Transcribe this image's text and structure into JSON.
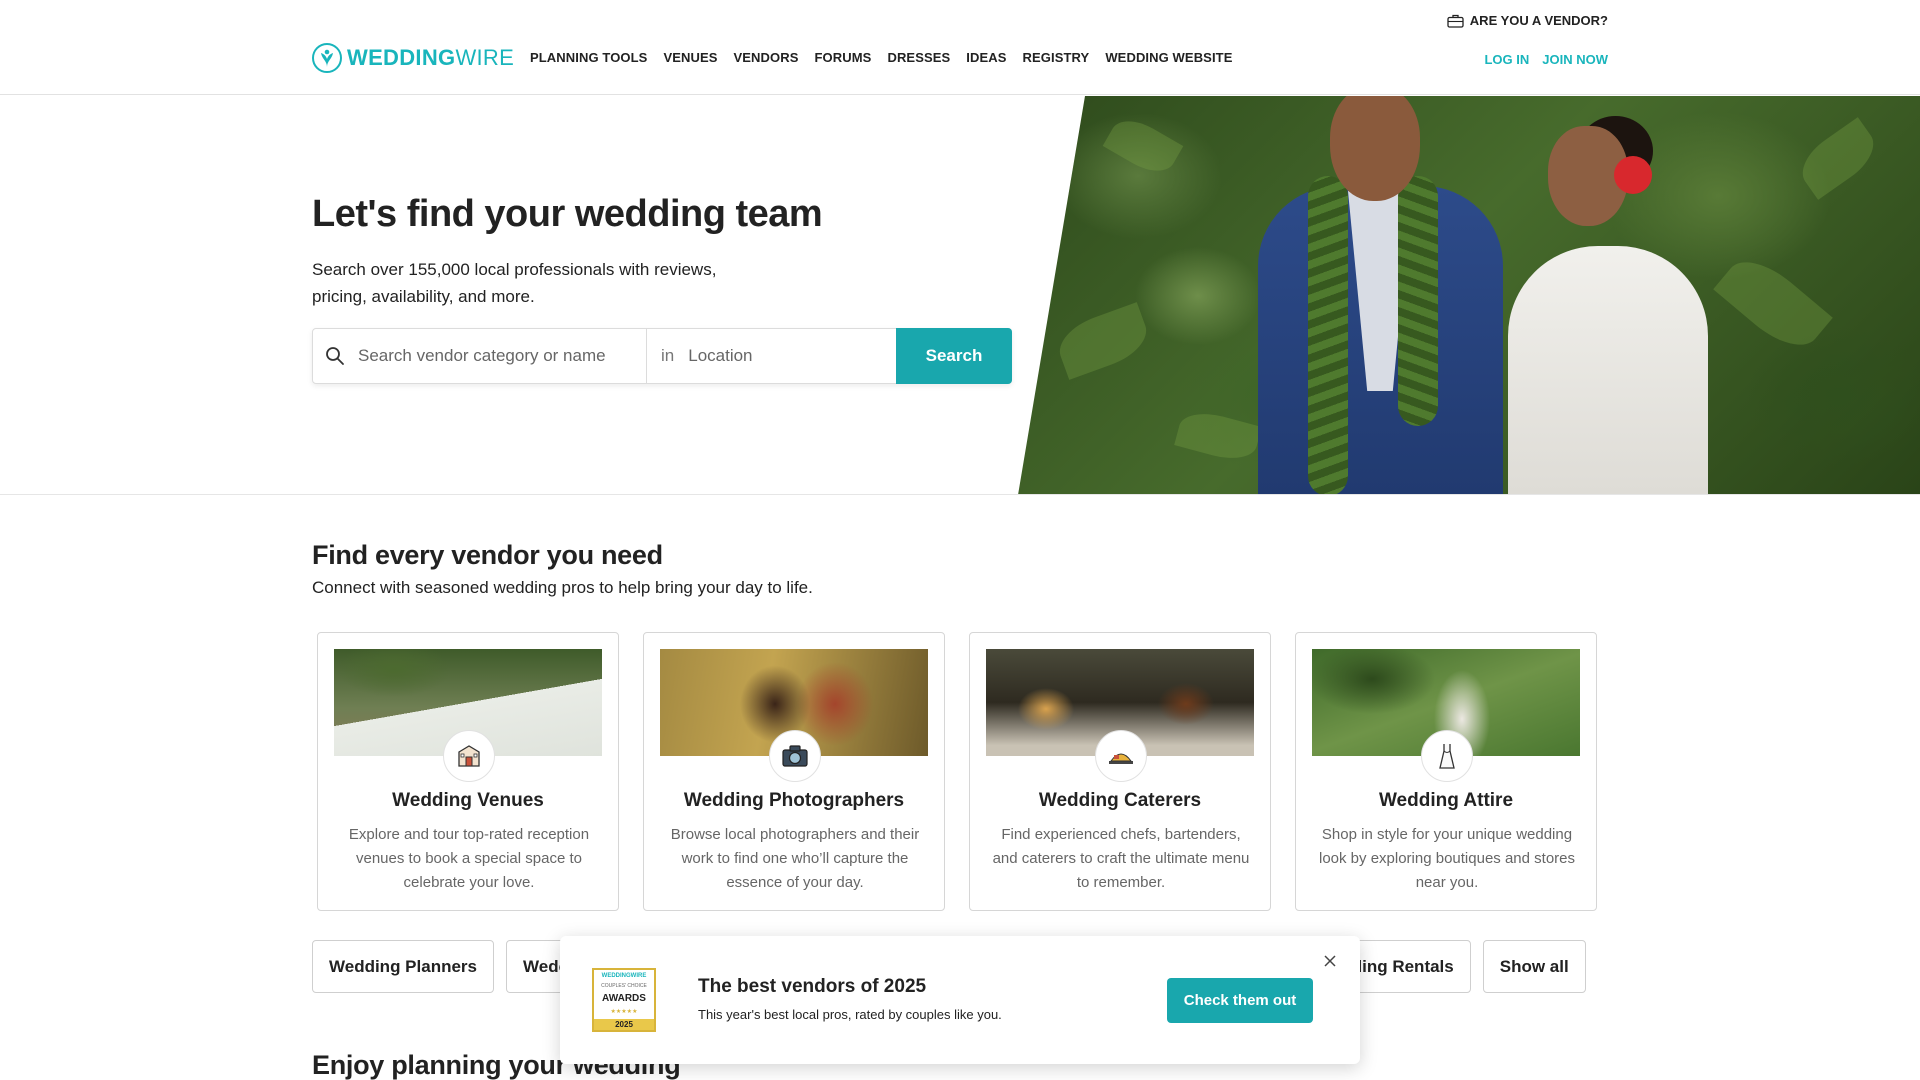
{
  "header": {
    "vendor_link": "ARE YOU A VENDOR?",
    "logo": {
      "part1": "WEDDING",
      "part2": "WIRE"
    },
    "nav": [
      "PLANNING TOOLS",
      "VENUES",
      "VENDORS",
      "FORUMS",
      "DRESSES",
      "IDEAS",
      "REGISTRY",
      "WEDDING WEBSITE"
    ],
    "login": "LOG IN",
    "join": "JOIN NOW"
  },
  "hero": {
    "title": "Let's find your wedding team",
    "subtitle": "Search over 155,000 local professionals with reviews, pricing, availability, and more.",
    "search": {
      "category_placeholder": "Search vendor category or name",
      "in_label": "in",
      "location_placeholder": "Location",
      "button": "Search"
    }
  },
  "vendors": {
    "title": "Find every vendor you need",
    "subtitle": "Connect with seasoned wedding pros to help bring your day to life.",
    "cards": [
      {
        "title": "Wedding Venues",
        "desc": "Explore and tour top-rated reception venues to book a special space to celebrate your love.",
        "icon": "venue-icon"
      },
      {
        "title": "Wedding Photographers",
        "desc": "Browse local photographers and their work to find one who’ll capture the essence of your day.",
        "icon": "camera-icon"
      },
      {
        "title": "Wedding Caterers",
        "desc": "Find experienced chefs, bartenders, and caterers to craft the ultimate menu to remember.",
        "icon": "catering-icon"
      },
      {
        "title": "Wedding Attire",
        "desc": "Shop in style for your unique wedding look by exploring boutiques and stores near you.",
        "icon": "dress-icon"
      }
    ],
    "pills": [
      "Wedding Planners",
      "Wedc",
      "lding Rentals",
      "Show all"
    ]
  },
  "next_section_title": "Enjoy planning your wedding",
  "toast": {
    "award": {
      "brand": "WEDDINGWIRE",
      "line": "COUPLES' CHOICE",
      "name": "AWARDS",
      "stars": "★★★★★",
      "year": "2025"
    },
    "title": "The best vendors of 2025",
    "subtitle": "This year's best local pros, rated by couples like you.",
    "button": "Check them out"
  },
  "colors": {
    "brand_teal": "#19b5bc",
    "button_teal": "#19a7ad",
    "award_gold": "#d8b43a"
  }
}
